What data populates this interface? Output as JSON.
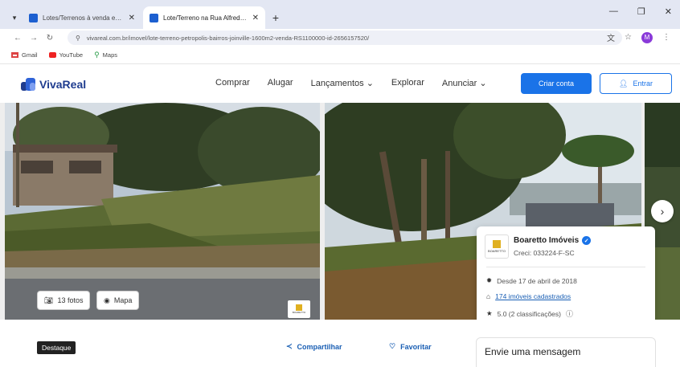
{
  "browser": {
    "tabs": [
      {
        "title": "Lotes/Terrenos à venda em Joi",
        "active": false
      },
      {
        "title": "Lote/Terreno na Rua Alfredo W",
        "active": true
      }
    ],
    "url": "vivareal.com.br/imovel/lote-terreno-petropolis-bairros-joinville-1600m2-venda-RS1100000-id-2656157520/",
    "bookmarks": [
      "Gmail",
      "YouTube",
      "Maps"
    ],
    "profile_initial": "M"
  },
  "site": {
    "logo_text": "VivaReal",
    "nav": [
      "Comprar",
      "Alugar",
      "Lançamentos",
      "Explorar",
      "Anunciar"
    ],
    "btn_criar": "Criar conta",
    "btn_entrar": "Entrar"
  },
  "gallery": {
    "photos_label": "13 fotos",
    "map_label": "Mapa"
  },
  "agent": {
    "name": "Boaretto Imóveis",
    "logo_text": "BOARETTO",
    "creci": "Creci: 033224-F-SC",
    "since": "Desde 17 de abril de 2018",
    "listings_link": "174 imóveis cadastrados",
    "rating": "5.0 (2 classificações)"
  },
  "bottom": {
    "tag": "Destaque",
    "share": "Compartilhar",
    "favorite": "Favoritar",
    "message_title": "Envie uma mensagem"
  },
  "colors": {
    "brand_blue": "#1a73e8",
    "logo_navy": "#1f3c8f"
  }
}
